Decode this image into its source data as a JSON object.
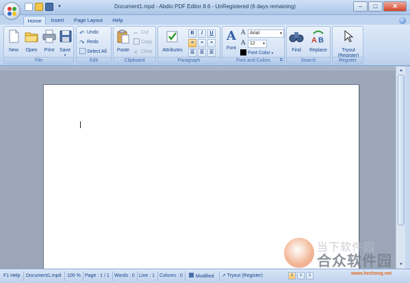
{
  "window": {
    "title": "Document1.mpd - Abdio PDF Editor 8.6 - UnRegistered (6 days remaining)",
    "minimize": "–",
    "maximize": "□",
    "close": "✕"
  },
  "tabs": [
    {
      "label": "Home",
      "active": true
    },
    {
      "label": "Insert"
    },
    {
      "label": "Page Layout"
    },
    {
      "label": "Help"
    }
  ],
  "ribbon": {
    "file": {
      "label": "File",
      "new": "New",
      "open": "Open",
      "print": "Print",
      "save": "Save"
    },
    "edit": {
      "label": "Edit",
      "undo": "Undo",
      "redo": "Redo",
      "select_all": "Select All"
    },
    "clipboard": {
      "label": "Clipboard",
      "paste": "Paste",
      "cut": "Cut",
      "copy": "Copy",
      "clear": "Clear"
    },
    "paragraph": {
      "label": "Paragraph",
      "attributes": "Attributes",
      "bold": "B",
      "italic": "I",
      "underline": "U"
    },
    "font": {
      "label": "Font and Colors",
      "font_button": "Font",
      "font_name": "Arial",
      "font_size": "12",
      "font_color": "Font Color"
    },
    "search": {
      "label": "Search",
      "find": "Find",
      "replace": "Replace"
    },
    "register": {
      "label": "Register",
      "tryout_line1": "Tryout",
      "tryout_line2": "(Register)"
    }
  },
  "status": {
    "help": "F1 Help",
    "document": "Document1.mpd",
    "zoom": "100 %",
    "page": "Page : 1 / 1",
    "words": "Words : 0",
    "line": "Line : 1",
    "column": "Column : 0",
    "modified": "Modified",
    "tryout": "Tryout (Register)"
  },
  "watermark": {
    "line1": "当下软件园",
    "line2": "合众软件园",
    "url": "www.hezhong.net"
  },
  "colors": {
    "ribbon_bg": "#dde9f8",
    "accent": "#15428b",
    "document_bg": "#9ba7b9"
  }
}
